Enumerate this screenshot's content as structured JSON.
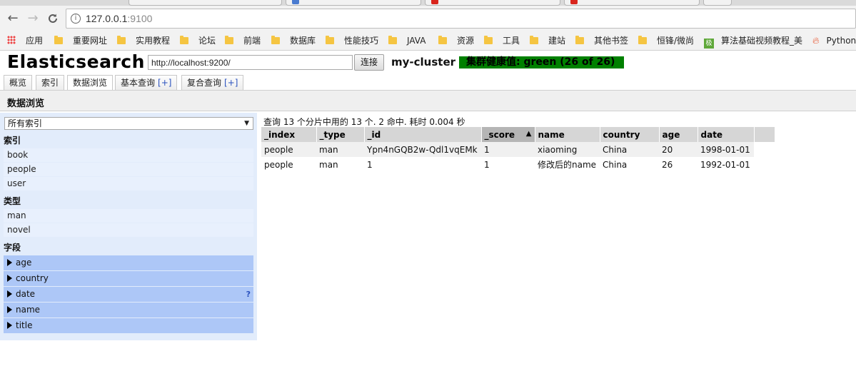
{
  "browser": {
    "url_host": "127.0.0.1",
    "url_port": ":9100",
    "nav": {
      "back": "←",
      "forward": "→",
      "reload": "C"
    }
  },
  "bookmarks": [
    {
      "label": "应用",
      "icon": "apps-icon"
    },
    {
      "label": "重要网址",
      "icon": "folder-icon"
    },
    {
      "label": "实用教程",
      "icon": "folder-icon"
    },
    {
      "label": "论坛",
      "icon": "folder-icon"
    },
    {
      "label": "前端",
      "icon": "folder-icon"
    },
    {
      "label": "数据库",
      "icon": "folder-icon"
    },
    {
      "label": "性能技巧",
      "icon": "folder-icon"
    },
    {
      "label": "JAVA",
      "icon": "folder-icon"
    },
    {
      "label": "资源",
      "icon": "folder-icon"
    },
    {
      "label": "工具",
      "icon": "folder-icon"
    },
    {
      "label": "建站",
      "icon": "folder-icon"
    },
    {
      "label": "其他书签",
      "icon": "folder-icon"
    },
    {
      "label": "恒锋/微尚",
      "icon": "folder-icon"
    },
    {
      "label": "算法基础视频教程_美",
      "icon": "green-icon",
      "icon_text": "极"
    },
    {
      "label": "Python",
      "icon": "flame-icon"
    }
  ],
  "app": {
    "title": "Elasticsearch",
    "connection_url": "http://localhost:9200/",
    "connect_label": "连接",
    "cluster_name": "my-cluster",
    "health_text": "集群健康值: green (26 of 26)",
    "health_color": "#008000"
  },
  "tabs": [
    {
      "label": "概览",
      "plus": ""
    },
    {
      "label": "索引",
      "plus": ""
    },
    {
      "label": "数据浏览",
      "plus": "",
      "active": true
    },
    {
      "label": "基本查询",
      "plus": "[+]"
    },
    {
      "label": "复合查询",
      "plus": "[+]"
    }
  ],
  "section_title": "数据浏览",
  "sidebar": {
    "index_select": "所有索引",
    "indices_heading": "索引",
    "indices": [
      "book",
      "people",
      "user"
    ],
    "types_heading": "类型",
    "types": [
      "man",
      "novel"
    ],
    "fields_heading": "字段",
    "fields": [
      "age",
      "country",
      "date",
      "name",
      "title"
    ],
    "help_mark": "?"
  },
  "results": {
    "summary": "查询 13 个分片中用的 13 个. 2 命中. 耗时 0.004 秒",
    "columns": [
      "_index",
      "_type",
      "_id",
      "_score",
      "name",
      "country",
      "age",
      "date"
    ],
    "sort_indicator": "▲",
    "rows": [
      [
        "people",
        "man",
        "Ypn4nGQB2w-Qdl1vqEMk",
        "1",
        "xiaoming",
        "China",
        "20",
        "1998-01-01"
      ],
      [
        "people",
        "man",
        "1",
        "1",
        "修改后的name",
        "China",
        "26",
        "1992-01-01"
      ]
    ]
  }
}
